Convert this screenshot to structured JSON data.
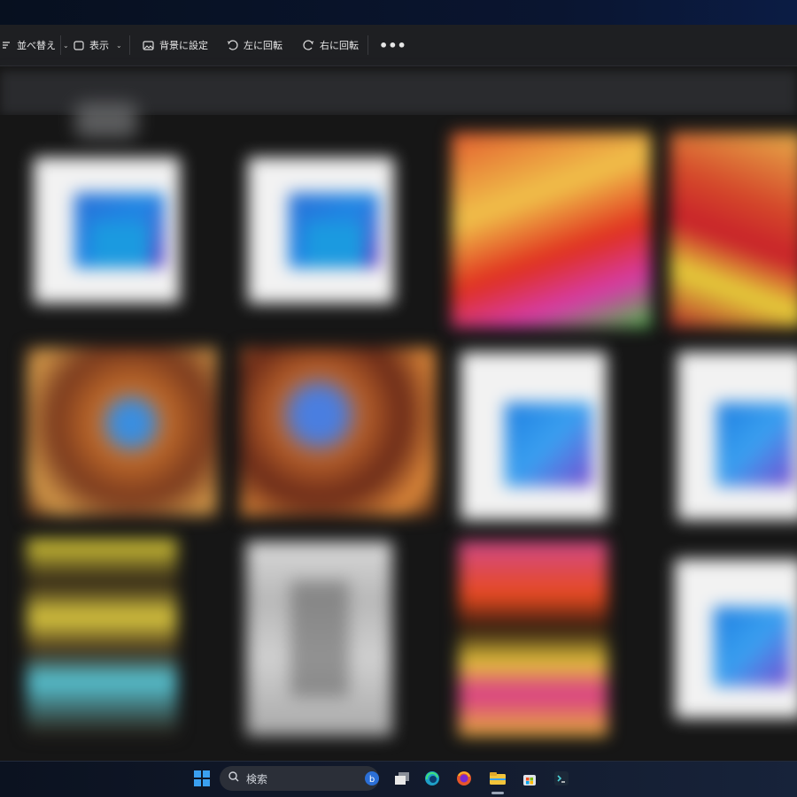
{
  "toolbar": {
    "sort_label": "並べ替え",
    "view_label": "表示",
    "set_background_label": "背景に設定",
    "rotate_left_label": "左に回転",
    "rotate_right_label": "右に回転",
    "more_label": "•••"
  },
  "thumbnails": [
    {
      "kind": "document"
    },
    {
      "kind": "document"
    },
    {
      "kind": "image"
    },
    {
      "kind": "image"
    },
    {
      "kind": "image"
    },
    {
      "kind": "image"
    },
    {
      "kind": "document"
    },
    {
      "kind": "document"
    },
    {
      "kind": "image"
    },
    {
      "kind": "image"
    },
    {
      "kind": "image"
    },
    {
      "kind": "document"
    }
  ],
  "taskbar": {
    "search_placeholder": "検索",
    "icons": [
      "windows-start-icon",
      "search-icon",
      "bing-icon",
      "task-view-icon",
      "edge-icon",
      "firefox-icon",
      "file-explorer-icon",
      "store-icon",
      "terminal-icon"
    ]
  },
  "colors": {
    "toolbar_bg": "#1e1f22",
    "content_bg": "#161616",
    "taskbar_bg": "#121a2c",
    "accent_blue": "#1e88e5"
  }
}
